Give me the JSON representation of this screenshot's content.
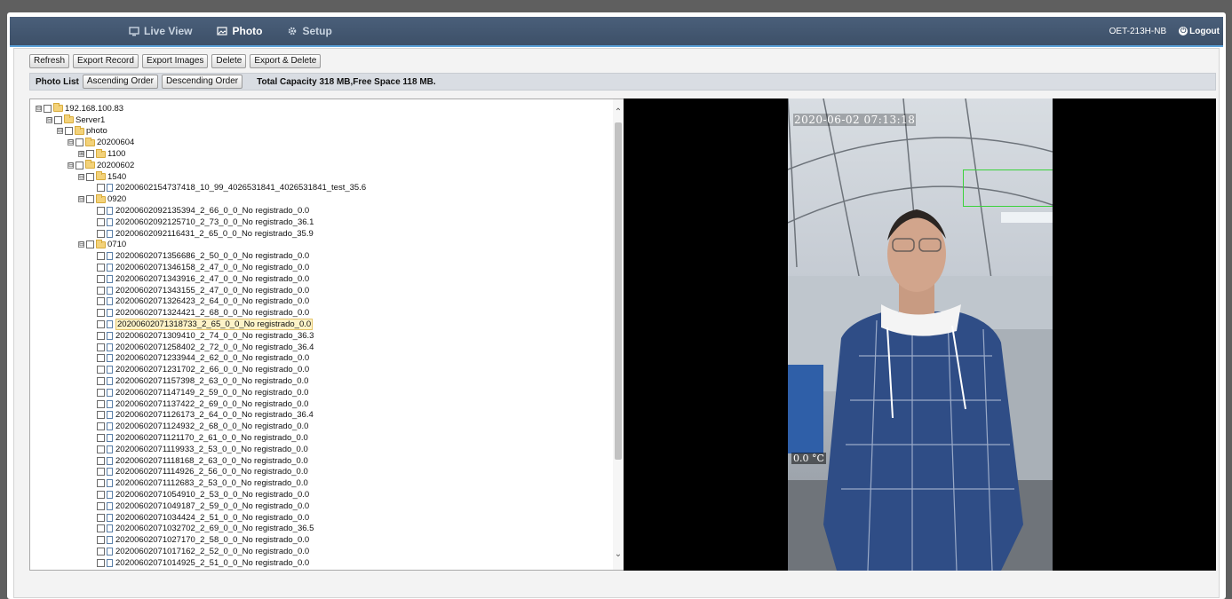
{
  "nav": {
    "tabs": [
      {
        "label": "Live View",
        "icon": "monitor-icon"
      },
      {
        "label": "Photo",
        "icon": "photo-icon"
      },
      {
        "label": "Setup",
        "icon": "gear-icon"
      }
    ],
    "device": "OET-213H-NB",
    "logout": "Logout"
  },
  "toolbar": {
    "refresh": "Refresh",
    "export_record": "Export Record",
    "export_images": "Export Images",
    "delete": "Delete",
    "export_delete": "Export & Delete"
  },
  "list_bar": {
    "label": "Photo List",
    "ascending": "Ascending Order",
    "descending": "Descending Order",
    "capacity": "Total Capacity 318 MB,Free Space 118 MB."
  },
  "tree": [
    {
      "level": 0,
      "type": "folder",
      "expander": "⊟",
      "label": "192.168.100.83"
    },
    {
      "level": 1,
      "type": "folder",
      "expander": "⊟",
      "label": "Server1"
    },
    {
      "level": 2,
      "type": "folder",
      "expander": "⊟",
      "label": "photo"
    },
    {
      "level": 3,
      "type": "folder",
      "expander": "⊟",
      "label": "20200604"
    },
    {
      "level": 4,
      "type": "folder",
      "expander": "⊞",
      "label": "1100"
    },
    {
      "level": 3,
      "type": "folder",
      "expander": "⊟",
      "label": "20200602"
    },
    {
      "level": 4,
      "type": "folder",
      "expander": "⊟",
      "label": "1540"
    },
    {
      "level": 5,
      "type": "file",
      "label": "20200602154737418_10_99_4026531841_4026531841_test_35.6"
    },
    {
      "level": 4,
      "type": "folder",
      "expander": "⊟",
      "label": "0920"
    },
    {
      "level": 5,
      "type": "file",
      "label": "20200602092135394_2_66_0_0_No registrado_0.0"
    },
    {
      "level": 5,
      "type": "file",
      "label": "20200602092125710_2_73_0_0_No registrado_36.1"
    },
    {
      "level": 5,
      "type": "file",
      "label": "20200602092116431_2_65_0_0_No registrado_35.9"
    },
    {
      "level": 4,
      "type": "folder",
      "expander": "⊟",
      "label": "0710"
    },
    {
      "level": 5,
      "type": "file",
      "label": "20200602071356686_2_50_0_0_No registrado_0.0"
    },
    {
      "level": 5,
      "type": "file",
      "label": "20200602071346158_2_47_0_0_No registrado_0.0"
    },
    {
      "level": 5,
      "type": "file",
      "label": "20200602071343916_2_47_0_0_No registrado_0.0"
    },
    {
      "level": 5,
      "type": "file",
      "label": "20200602071343155_2_47_0_0_No registrado_0.0"
    },
    {
      "level": 5,
      "type": "file",
      "label": "20200602071326423_2_64_0_0_No registrado_0.0"
    },
    {
      "level": 5,
      "type": "file",
      "label": "20200602071324421_2_68_0_0_No registrado_0.0"
    },
    {
      "level": 5,
      "type": "file",
      "label": "20200602071318733_2_65_0_0_No registrado_0.0",
      "selected": true
    },
    {
      "level": 5,
      "type": "file",
      "label": "20200602071309410_2_74_0_0_No registrado_36.3"
    },
    {
      "level": 5,
      "type": "file",
      "label": "20200602071258402_2_72_0_0_No registrado_36.4"
    },
    {
      "level": 5,
      "type": "file",
      "label": "20200602071233944_2_62_0_0_No registrado_0.0"
    },
    {
      "level": 5,
      "type": "file",
      "label": "20200602071231702_2_66_0_0_No registrado_0.0"
    },
    {
      "level": 5,
      "type": "file",
      "label": "20200602071157398_2_63_0_0_No registrado_0.0"
    },
    {
      "level": 5,
      "type": "file",
      "label": "20200602071147149_2_59_0_0_No registrado_0.0"
    },
    {
      "level": 5,
      "type": "file",
      "label": "20200602071137422_2_69_0_0_No registrado_0.0"
    },
    {
      "level": 5,
      "type": "file",
      "label": "20200602071126173_2_64_0_0_No registrado_36.4"
    },
    {
      "level": 5,
      "type": "file",
      "label": "20200602071124932_2_68_0_0_No registrado_0.0"
    },
    {
      "level": 5,
      "type": "file",
      "label": "20200602071121170_2_61_0_0_No registrado_0.0"
    },
    {
      "level": 5,
      "type": "file",
      "label": "20200602071119933_2_53_0_0_No registrado_0.0"
    },
    {
      "level": 5,
      "type": "file",
      "label": "20200602071118168_2_63_0_0_No registrado_0.0"
    },
    {
      "level": 5,
      "type": "file",
      "label": "20200602071114926_2_56_0_0_No registrado_0.0"
    },
    {
      "level": 5,
      "type": "file",
      "label": "20200602071112683_2_53_0_0_No registrado_0.0"
    },
    {
      "level": 5,
      "type": "file",
      "label": "20200602071054910_2_53_0_0_No registrado_0.0"
    },
    {
      "level": 5,
      "type": "file",
      "label": "20200602071049187_2_59_0_0_No registrado_0.0"
    },
    {
      "level": 5,
      "type": "file",
      "label": "20200602071034424_2_51_0_0_No registrado_0.0"
    },
    {
      "level": 5,
      "type": "file",
      "label": "20200602071032702_2_69_0_0_No registrado_36.5"
    },
    {
      "level": 5,
      "type": "file",
      "label": "20200602071027170_2_58_0_0_No registrado_0.0"
    },
    {
      "level": 5,
      "type": "file",
      "label": "20200602071017162_2_52_0_0_No registrado_0.0"
    },
    {
      "level": 5,
      "type": "file",
      "label": "20200602071014925_2_51_0_0_No registrado_0.0"
    }
  ],
  "viewer": {
    "timestamp": "2020-06-02 07:13:18",
    "temperature": "0.0 °C"
  },
  "colors": {
    "nav_bg": "#3d5068",
    "nav_accent": "#5aa0d8",
    "detection_box": "#3bd23b",
    "selected_row": "#fdf3c8"
  }
}
